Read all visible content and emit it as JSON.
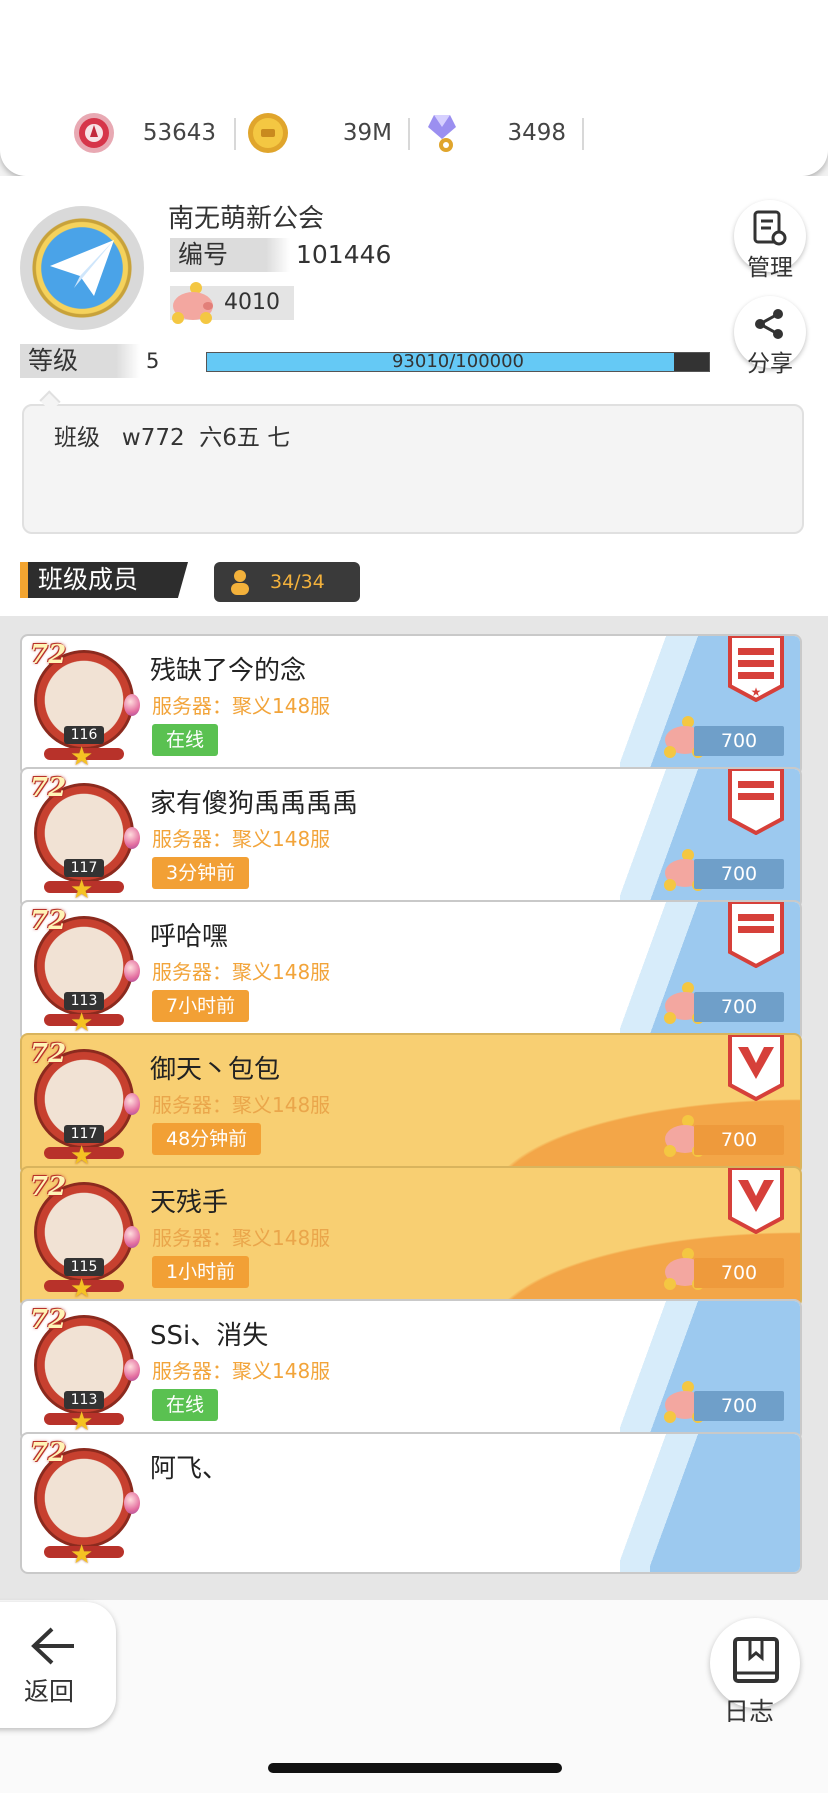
{
  "resources": [
    {
      "icon": "red-token-icon",
      "value": "53643"
    },
    {
      "icon": "gold-coin-icon",
      "value": "39M"
    },
    {
      "icon": "crystal-key-icon",
      "value": "3498"
    }
  ],
  "guild": {
    "name": "南无萌新公会",
    "id_label": "编号",
    "id": "101446",
    "funds": "4010",
    "level_label": "等级",
    "level": "5",
    "xp_text": "93010/100000",
    "xp_fraction": 0.9301,
    "notice": "班级   w772  六6五 七"
  },
  "side_buttons": {
    "manage": "管理",
    "share": "分享"
  },
  "members_section": {
    "title": "班级成员",
    "count": "34/34"
  },
  "members": [
    {
      "name": "残缺了今的念",
      "server": "服务器：聚义148服",
      "status": "在线",
      "status_type": "online",
      "hero_level": "116",
      "contribution": "700",
      "theme": "white",
      "rank": "leader"
    },
    {
      "name": "家有傻狗禹禹禹禹",
      "server": "服务器：聚义148服",
      "status": "3分钟前",
      "status_type": "away",
      "hero_level": "117",
      "contribution": "700",
      "theme": "white",
      "rank": "officer"
    },
    {
      "name": "呼哈嘿",
      "server": "服务器：聚义148服",
      "status": "7小时前",
      "status_type": "away",
      "hero_level": "113",
      "contribution": "700",
      "theme": "white",
      "rank": "officer"
    },
    {
      "name": "御天丶包包",
      "server": "服务器：聚义148服",
      "status": "48分钟前",
      "status_type": "away",
      "hero_level": "117",
      "contribution": "700",
      "theme": "gold",
      "rank": "elite"
    },
    {
      "name": "天残手",
      "server": "服务器：聚义148服",
      "status": "1小时前",
      "status_type": "away",
      "hero_level": "115",
      "contribution": "700",
      "theme": "gold",
      "rank": "elite"
    },
    {
      "name": "SSi、消失",
      "server": "服务器：聚义148服",
      "status": "在线",
      "status_type": "online",
      "hero_level": "113",
      "contribution": "700",
      "theme": "white",
      "rank": "none"
    },
    {
      "name": "阿飞、",
      "server": "",
      "status": "",
      "status_type": "none",
      "hero_level": "",
      "contribution": "",
      "theme": "white",
      "rank": "none"
    }
  ],
  "avatar_badge": "72",
  "bottom": {
    "back": "返回",
    "log": "日志"
  }
}
